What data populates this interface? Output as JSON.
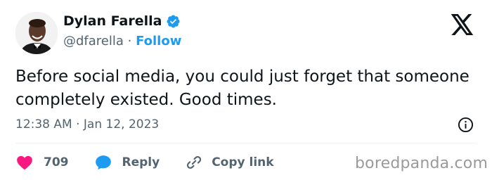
{
  "author": {
    "display_name": "Dylan Farella",
    "handle": "@dfarella",
    "separator": " · ",
    "follow_label": "Follow",
    "verified": true
  },
  "tweet": {
    "text": "Before social media, you could just forget that someone completely existed. Good times.",
    "timestamp": "12:38 AM · Jan 12, 2023"
  },
  "actions": {
    "likes_count": "709",
    "reply_label": "Reply",
    "copy_link_label": "Copy link"
  },
  "watermark": "boredpanda.com",
  "colors": {
    "accent": "#1d9bf0",
    "like": "#f91880",
    "text": "#0f1419",
    "secondary": "#536471"
  },
  "icons": {
    "verified": "verified-badge-icon",
    "x_logo": "x-logo-icon",
    "info": "info-icon",
    "like": "heart-icon",
    "reply": "speech-bubble-icon",
    "copy_link": "link-icon"
  }
}
